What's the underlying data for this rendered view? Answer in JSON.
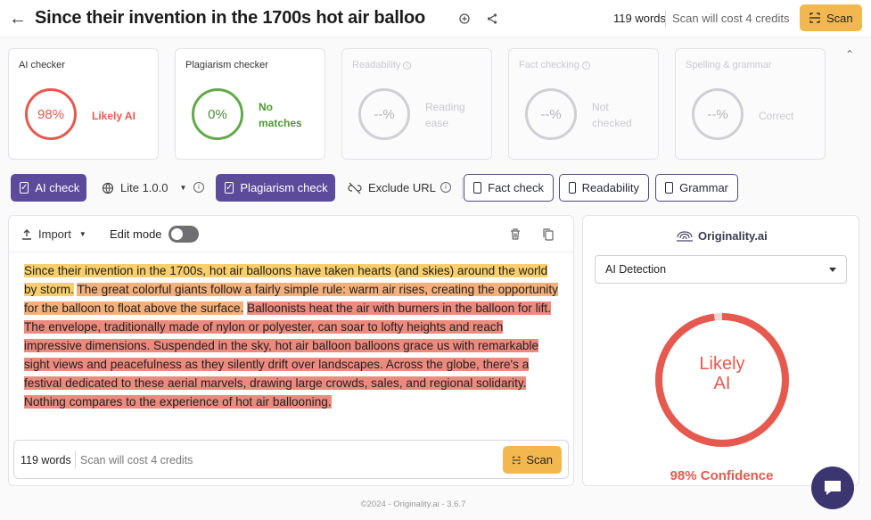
{
  "header": {
    "title": "Since their invention in the 1700s hot air balloo",
    "words": "119 words",
    "cost": "Scan will cost 4 credits",
    "scan_label": "Scan"
  },
  "cards": [
    {
      "title": "AI checker",
      "value": "98%",
      "label": "Likely AI",
      "status": "red",
      "enabled": true
    },
    {
      "title": "Plagiarism checker",
      "value": "0%",
      "label_lines": [
        "No",
        "matches"
      ],
      "status": "green",
      "enabled": true
    },
    {
      "title": "Readability",
      "value": "--%",
      "label_lines": [
        "Reading",
        "ease"
      ],
      "status": "gray",
      "enabled": false
    },
    {
      "title": "Fact checking",
      "value": "--%",
      "label_lines": [
        "Not",
        "checked"
      ],
      "status": "gray",
      "enabled": false
    },
    {
      "title": "Spelling & grammar",
      "value": "--%",
      "label": "Correct",
      "status": "gray",
      "enabled": false
    }
  ],
  "toolbar": {
    "ai_check": "AI check",
    "model": "Lite 1.0.0",
    "plagiarism_check": "Plagiarism check",
    "exclude_url": "Exclude URL",
    "fact_check": "Fact check",
    "readability": "Readability",
    "grammar": "Grammar"
  },
  "editor": {
    "import_label": "Import",
    "edit_mode_label": "Edit mode",
    "edit_mode_on": false,
    "segments": [
      {
        "text": "Since their invention in the 1700s, hot air balloons have taken hearts (and skies) around the world by storm.",
        "level": "yellow"
      },
      {
        "text": " ",
        "level": "none"
      },
      {
        "text": "The great colorful giants follow a fairly simple rule: warm air rises, creating the opportunity for the balloon to float above the surface.",
        "level": "orange"
      },
      {
        "text": " ",
        "level": "none"
      },
      {
        "text": "Balloonists heat the air with burners in the balloon for lift. The envelope, traditionally made of nylon or polyester, can soar to lofty heights and reach impressive dimensions. Suspended in the sky, hot air balloon balloons grace us with remarkable sight views and peacefulness as they silently drift over landscapes. Across the globe, there's a festival dedicated to these aerial marvels, drawing large crowds, sales, and regional solidarity. Nothing compares to the experience of hot air ballooning.",
        "level": "red"
      }
    ],
    "words": "119 words",
    "cost": "Scan will cost 4 credits",
    "scan_label": "Scan"
  },
  "result": {
    "brand": "Originality.ai",
    "dropdown_value": "AI Detection",
    "verdict_line1": "Likely",
    "verdict_line2": "AI",
    "ai_score": 0.98,
    "confidence": "98% Confidence"
  },
  "footer": "©2024 - Originality.ai - 3.6.7",
  "colors": {
    "accent_purple": "#5c4b9a",
    "scan_yellow": "#f2b84f",
    "ai_red": "#e5594f",
    "match_green": "#62a948"
  }
}
